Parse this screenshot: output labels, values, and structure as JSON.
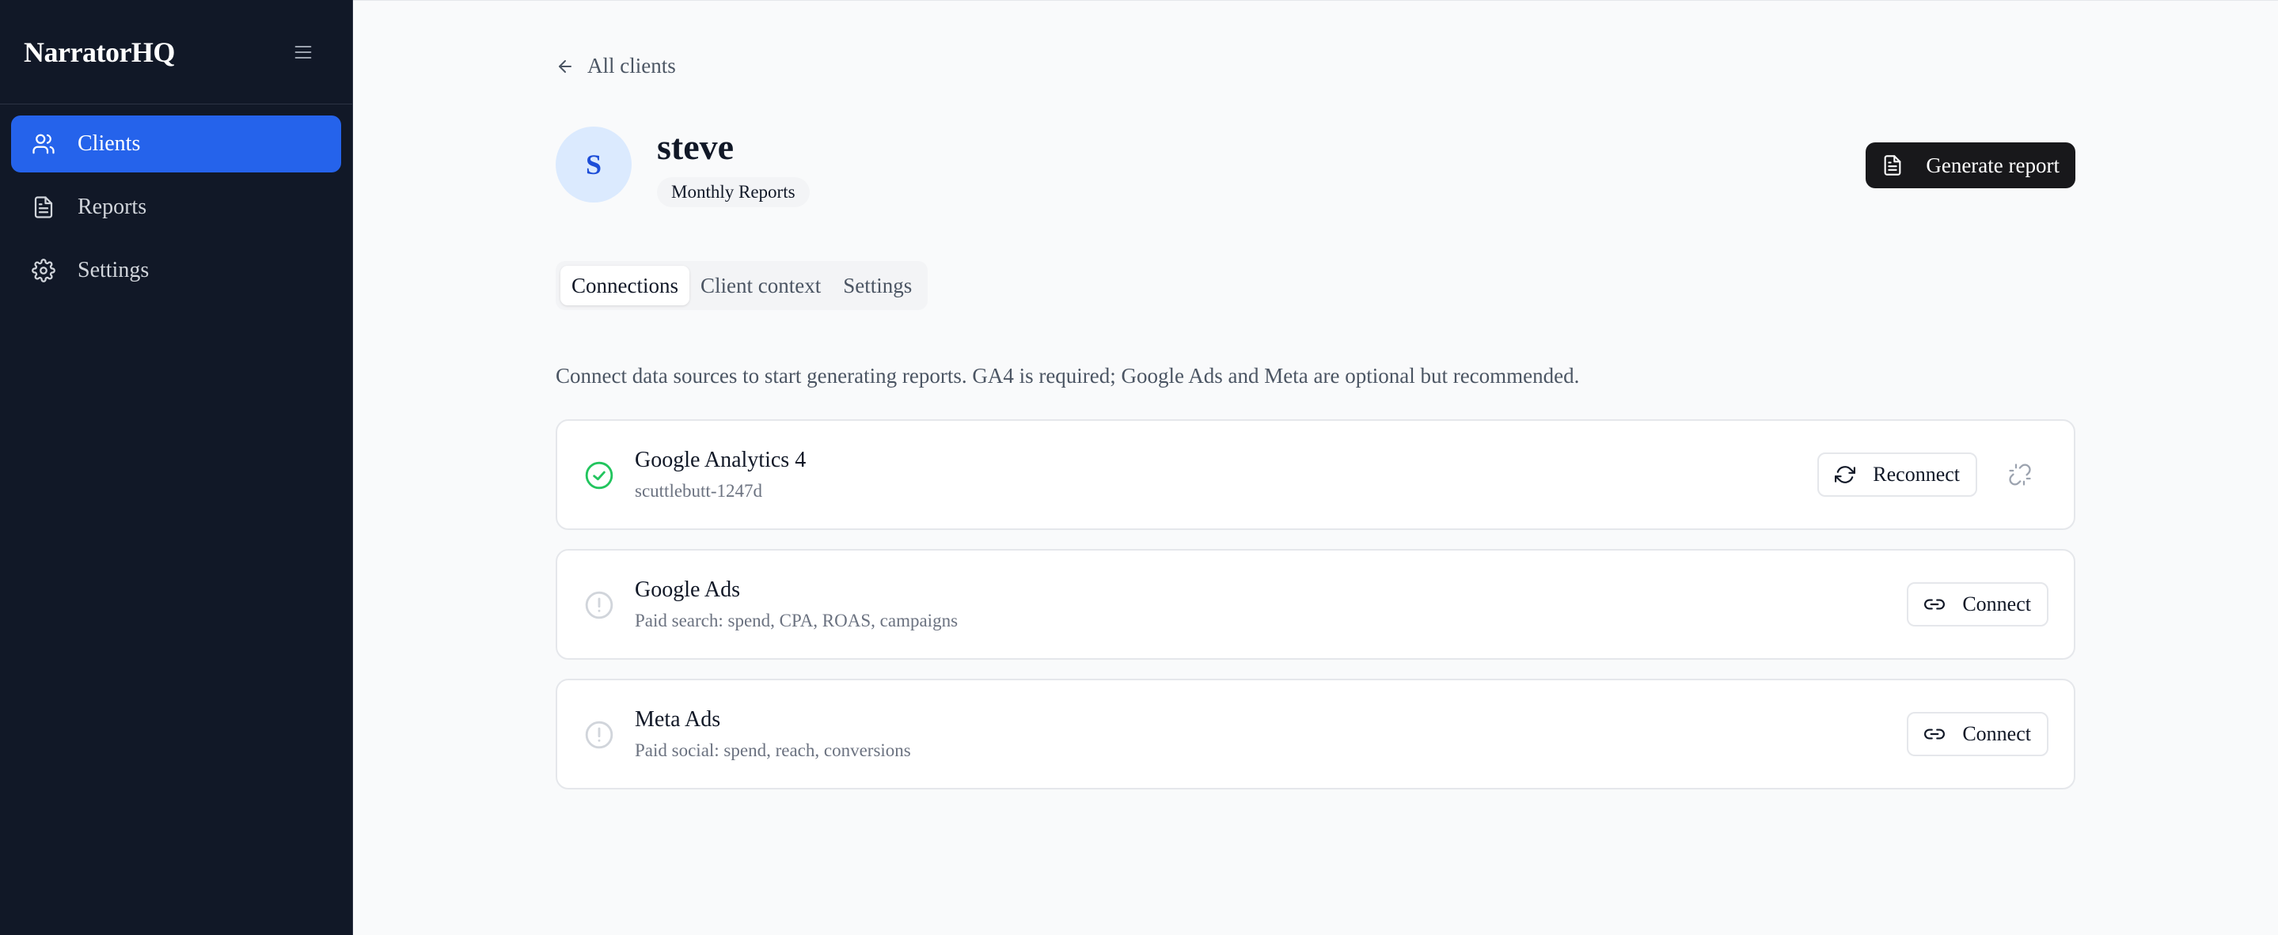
{
  "sidebar": {
    "brand": "NarratorHQ",
    "items": [
      {
        "label": "Clients",
        "icon": "users-icon",
        "active": true
      },
      {
        "label": "Reports",
        "icon": "document-icon",
        "active": false
      },
      {
        "label": "Settings",
        "icon": "gear-icon",
        "active": false
      }
    ]
  },
  "breadcrumb": {
    "back_label": "All clients"
  },
  "client": {
    "initial": "S",
    "name": "steve",
    "badge": "Monthly Reports"
  },
  "header": {
    "generate_label": "Generate report"
  },
  "tabs": [
    {
      "label": "Connections",
      "active": true
    },
    {
      "label": "Client context",
      "active": false
    },
    {
      "label": "Settings",
      "active": false
    }
  ],
  "intro_text": "Connect data sources to start generating reports. GA4 is required; Google Ads and Meta are optional but recommended.",
  "connections": [
    {
      "title": "Google Analytics 4",
      "subtitle": "scuttlebutt-1247d",
      "status": "connected",
      "action_label": "Reconnect"
    },
    {
      "title": "Google Ads",
      "subtitle": "Paid search: spend, CPA, ROAS, campaigns",
      "status": "not-connected",
      "action_label": "Connect"
    },
    {
      "title": "Meta Ads",
      "subtitle": "Paid social: spend, reach, conversions",
      "status": "not-connected",
      "action_label": "Connect"
    }
  ],
  "colors": {
    "sidebar_bg": "#111827",
    "accent": "#2563eb",
    "connected_green": "#22c55e",
    "primary_button": "#18181b"
  }
}
